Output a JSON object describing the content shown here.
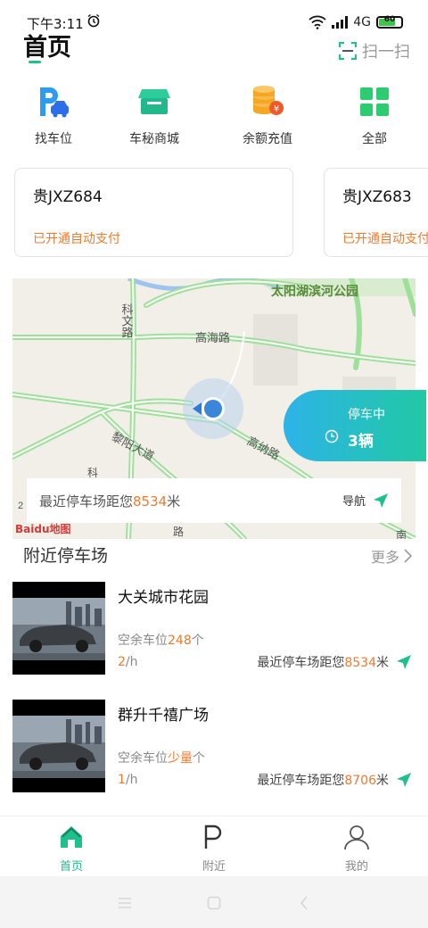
{
  "status_bar": {
    "time": "下午3:11",
    "network": "4G",
    "battery": "60"
  },
  "header": {
    "title": "首页",
    "scan_label": "扫一扫"
  },
  "shortcuts": [
    {
      "label": "找车位",
      "icon": "parking-car-icon"
    },
    {
      "label": "车秘商城",
      "icon": "shop-icon"
    },
    {
      "label": "余额充值",
      "icon": "coin-recharge-icon"
    },
    {
      "label": "全部",
      "icon": "grid-icon"
    }
  ],
  "plates": [
    {
      "plate": "贵JXZ684",
      "status": "已开通自动支付"
    },
    {
      "plate": "贵JXZ683",
      "status": "已开通自动支付"
    }
  ],
  "map": {
    "labels": [
      "太阳湖滨河公园",
      "高海路",
      "科文路",
      "黎阳大道",
      "高纳路",
      "科",
      "2",
      "路",
      "南"
    ],
    "parking_status": "停车中",
    "parking_count": "3辆",
    "nearest_prefix": "最近停车场距您",
    "nearest_distance": "8534",
    "nearest_unit": "米",
    "nav_label": "导航",
    "baidu_logo": "Baidu地图"
  },
  "nearby": {
    "title": "附近停车场",
    "more_label": "更多",
    "lots": [
      {
        "name": "大关城市花园",
        "spaces_prefix": "空余车位",
        "spaces": "248",
        "spaces_suffix": "个",
        "price_value": "2",
        "price_unit": "/h",
        "dist_prefix": "最近停车场距您",
        "dist": "8534",
        "dist_unit": "米"
      },
      {
        "name": "群升千禧广场",
        "spaces_prefix": "空余车位",
        "spaces": "少量",
        "spaces_suffix": "个",
        "price_value": "1",
        "price_unit": "/h",
        "dist_prefix": "最近停车场距您",
        "dist": "8706",
        "dist_unit": "米"
      }
    ]
  },
  "tabbar": [
    {
      "label": "首页",
      "active": true
    },
    {
      "label": "附近",
      "active": false
    },
    {
      "label": "我的",
      "active": false
    }
  ],
  "colors": {
    "accent": "#1ec18a",
    "orange": "#f07a2e",
    "blue": "#2db3e8"
  }
}
